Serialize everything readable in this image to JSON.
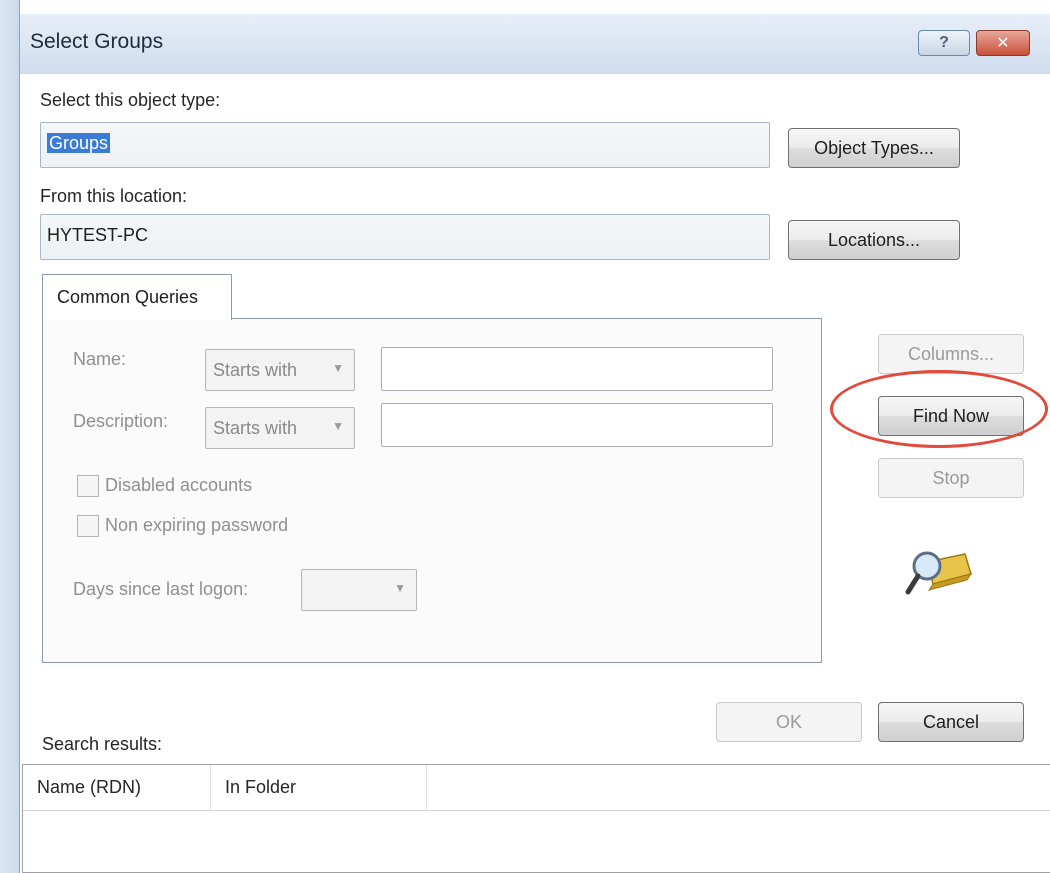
{
  "window": {
    "title": "Select Groups",
    "help_glyph": "?",
    "close_glyph": "✕"
  },
  "object_type": {
    "label": "Select this object type:",
    "value": "Groups",
    "button": "Object Types..."
  },
  "location": {
    "label": "From this location:",
    "value": "HYTEST-PC",
    "button": "Locations..."
  },
  "tabs": [
    {
      "label": "Common Queries"
    }
  ],
  "query": {
    "name_label": "Name:",
    "name_mode": "Starts with",
    "name_value": "",
    "description_label": "Description:",
    "description_mode": "Starts with",
    "description_value": "",
    "disabled_accounts_label": "Disabled accounts",
    "disabled_accounts_checked": false,
    "non_expiring_label": "Non expiring password",
    "non_expiring_checked": false,
    "days_label": "Days since last logon:",
    "days_value": ""
  },
  "side_buttons": {
    "columns": "Columns...",
    "find_now": "Find Now",
    "stop": "Stop"
  },
  "dialog_buttons": {
    "ok": "OK",
    "cancel": "Cancel"
  },
  "results": {
    "label": "Search results:",
    "columns": [
      "Name (RDN)",
      "In Folder"
    ],
    "rows": []
  },
  "icons": {
    "find": "folder-magnifier-icon",
    "dropdown": "chevron-down-icon"
  },
  "colors": {
    "highlight": "#e24a3b",
    "selection": "#3a7bd5"
  }
}
